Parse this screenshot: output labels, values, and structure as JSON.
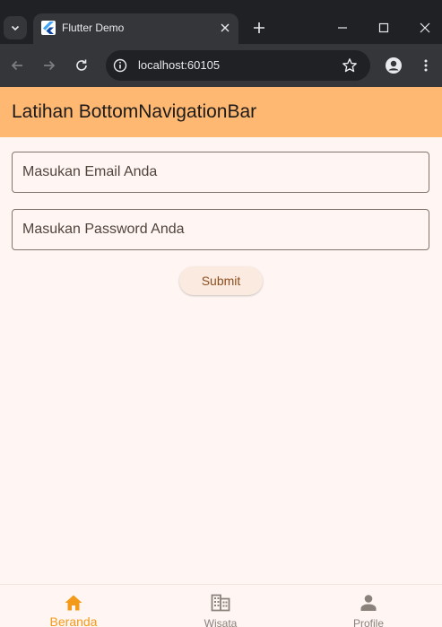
{
  "browser": {
    "tab": {
      "title": "Flutter Demo",
      "favicon": "flutter-logo"
    },
    "address": {
      "url": "localhost:60105"
    },
    "icons": {
      "tab_list": "chevron-down-icon",
      "tab_close": "close-icon",
      "new_tab": "plus-icon",
      "minimize": "minimize-icon",
      "maximize": "maximize-icon",
      "close_window": "close-icon",
      "back": "back-arrow-icon",
      "forward": "forward-arrow-icon",
      "reload": "reload-icon",
      "site_info": "info-icon",
      "bookmark": "star-icon",
      "profile": "profile-icon",
      "menu": "more-vert-icon"
    }
  },
  "app": {
    "title": "Latihan BottomNavigationBar",
    "email_placeholder": "Masukan Email Anda",
    "password_placeholder": "Masukan Password Anda",
    "submit_label": "Submit"
  },
  "bottom_nav": {
    "items": [
      {
        "label": "Beranda",
        "icon": "home-icon",
        "active": true
      },
      {
        "label": "Wisata",
        "icon": "business-icon",
        "active": false
      },
      {
        "label": "Profile",
        "icon": "person-icon",
        "active": false
      }
    ]
  },
  "colors": {
    "appbar": "#ffb871",
    "background": "#fff6f3",
    "active_nav": "#f49a1a",
    "inactive_nav": "#8a817b",
    "button_text": "#8b5020"
  }
}
